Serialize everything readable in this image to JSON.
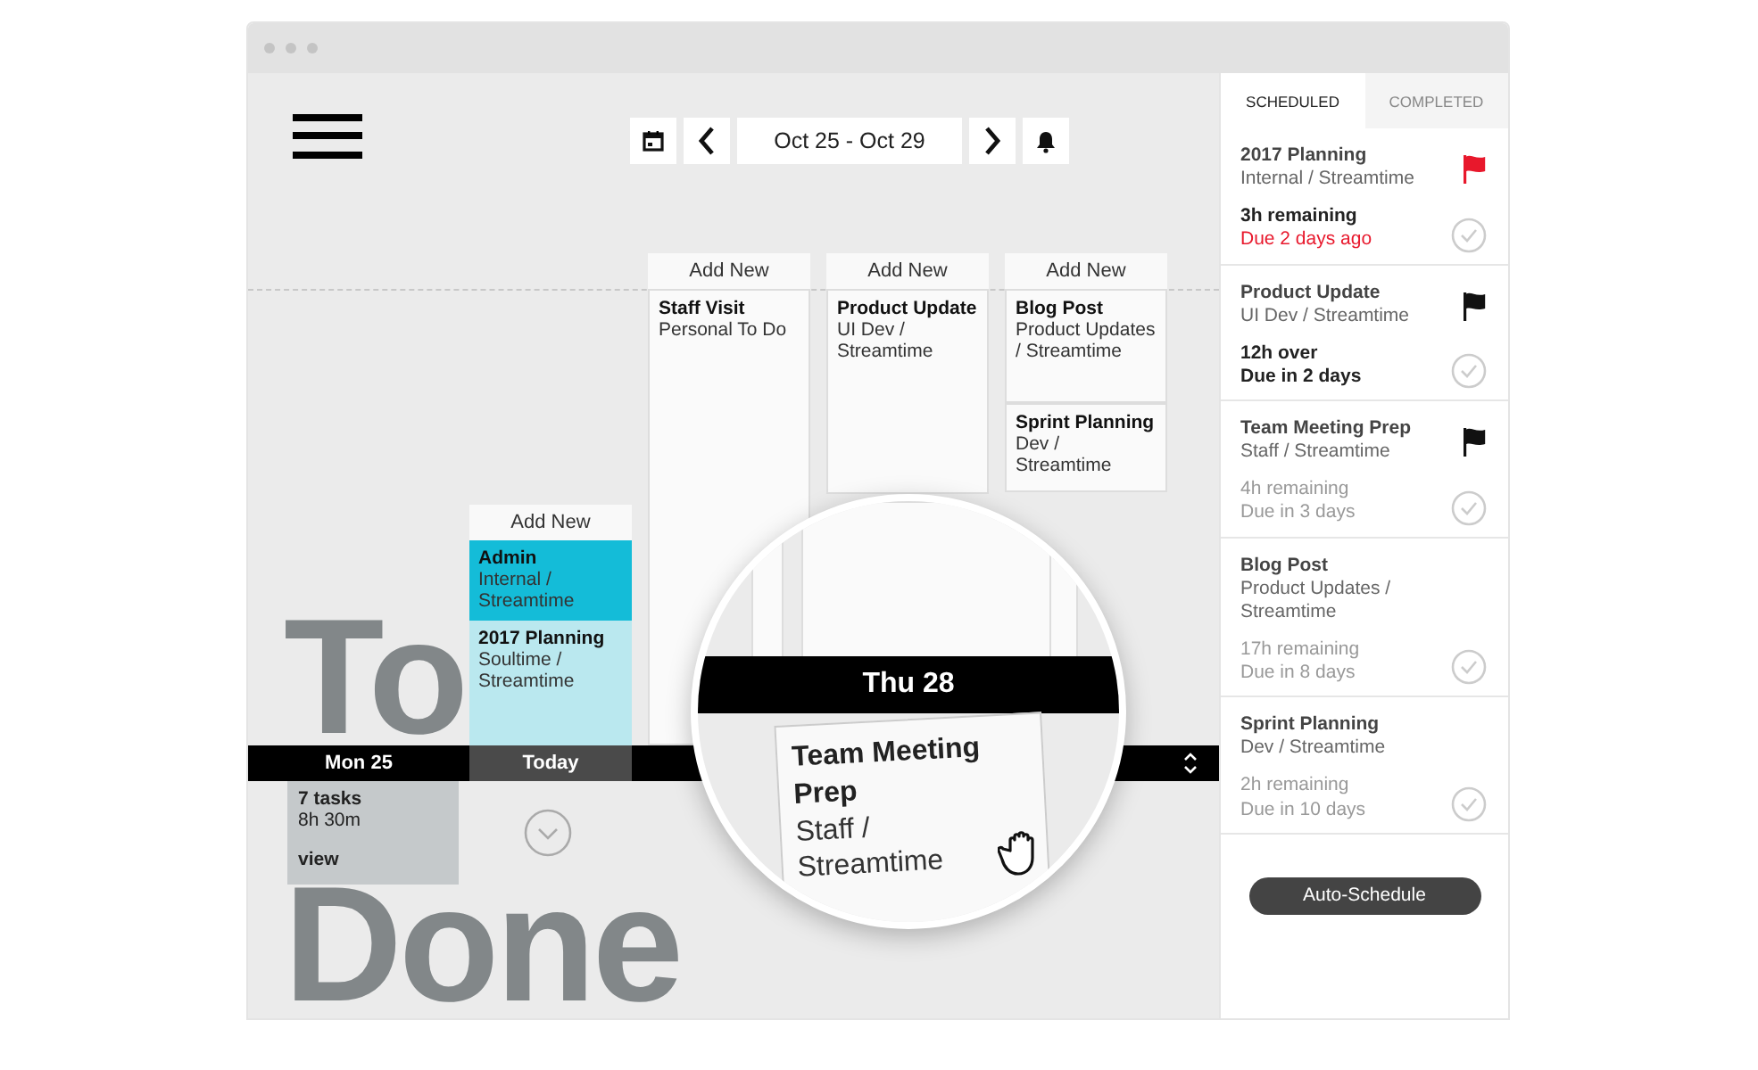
{
  "toolbar": {
    "date_range": "Oct 25 - Oct 29"
  },
  "columns": [
    {
      "kind": "empty"
    },
    {
      "kind": "today",
      "add_label": "Add New",
      "cards": [
        {
          "title": "Admin",
          "subtitle": "Internal / Streamtime",
          "kind": "highlight"
        },
        {
          "title": "2017 Planning",
          "subtitle": "Soultime / Streamtime",
          "kind": "tinted"
        }
      ]
    },
    {
      "kind": "day",
      "add_label": "Add New",
      "cards": [
        {
          "title": "Staff Visit",
          "subtitle": "Personal To Do",
          "kind": "plain"
        }
      ]
    },
    {
      "kind": "day",
      "add_label": "Add New",
      "cards": [
        {
          "title": "Product Update",
          "subtitle": "UI Dev / Streamtime",
          "kind": "short"
        }
      ]
    },
    {
      "kind": "day",
      "add_label": "Add New",
      "cards": [
        {
          "title": "Blog Post",
          "subtitle": "Product Updates / Streamtime",
          "kind": "short"
        },
        {
          "title": "Sprint Planning",
          "subtitle": "Dev / Streamtime",
          "kind": "short"
        }
      ]
    }
  ],
  "background_words": [
    "To",
    "Done"
  ],
  "day_bar": [
    {
      "label": "Mon 25",
      "selected": false
    },
    {
      "label": "Today",
      "selected": true
    }
  ],
  "summary": {
    "count": "7 tasks",
    "hours": "8h 30m",
    "link": "view"
  },
  "magnifier": {
    "day_label": "Thu 28",
    "card_title": "Team Meeting Prep",
    "card_subtitle": "Staff / Streamtime"
  },
  "panel": {
    "tabs": [
      {
        "label": "SCHEDULED",
        "selected": true
      },
      {
        "label": "COMPLETED",
        "selected": false
      }
    ],
    "tasks": [
      {
        "title": "2017 Planning",
        "subtitle": "Internal / Streamtime",
        "remaining": "3h remaining",
        "due": "Due 2 days ago",
        "overdue": true,
        "dimmed": false,
        "color": "#e8182c"
      },
      {
        "title": "Product Update",
        "subtitle": "UI Dev / Streamtime",
        "remaining": "12h over",
        "due": "Due in 2 days",
        "overdue": false,
        "dimmed": false,
        "color": "#111111"
      },
      {
        "title": "Team Meeting Prep",
        "subtitle": "Staff / Streamtime",
        "remaining": "4h remaining",
        "due": "Due in 3 days",
        "overdue": false,
        "dimmed": true,
        "color": "#111111"
      },
      {
        "title": "Blog Post",
        "subtitle": "Product Updates / Streamtime",
        "remaining": "17h remaining",
        "due": "Due in 8 days",
        "overdue": false,
        "dimmed": true
      },
      {
        "title": "Sprint Planning",
        "subtitle": "Dev / Streamtime",
        "remaining": "2h remaining",
        "due": "Due in 10 days",
        "overdue": false,
        "dimmed": true
      }
    ],
    "button": "Auto-Schedule"
  }
}
